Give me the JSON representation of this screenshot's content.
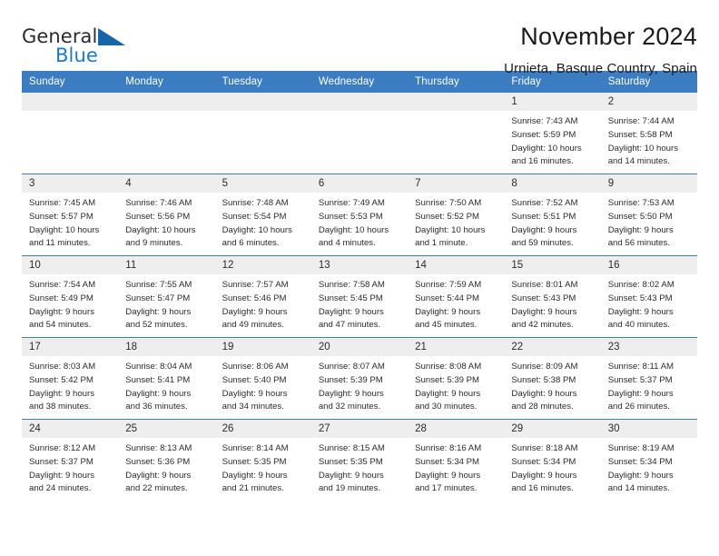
{
  "brand": {
    "name_part1": "General",
    "name_part2": "Blue",
    "triangle_color": "#1565a8",
    "blue_color": "#1f7ac4"
  },
  "header": {
    "title": "November 2024",
    "subtitle": "Urnieta, Basque Country, Spain"
  },
  "theme": {
    "header_blue": "#3b7dc0",
    "daynum_band": "#eeeeee",
    "text": "#2b2b2b"
  },
  "weekday_headers": [
    "Sunday",
    "Monday",
    "Tuesday",
    "Wednesday",
    "Thursday",
    "Friday",
    "Saturday"
  ],
  "weeks": [
    {
      "days": [
        {
          "num": "",
          "blank": true,
          "sunrise": "",
          "sunset": "",
          "daylight_line1": "",
          "daylight_line2": ""
        },
        {
          "num": "",
          "blank": true,
          "sunrise": "",
          "sunset": "",
          "daylight_line1": "",
          "daylight_line2": ""
        },
        {
          "num": "",
          "blank": true,
          "sunrise": "",
          "sunset": "",
          "daylight_line1": "",
          "daylight_line2": ""
        },
        {
          "num": "",
          "blank": true,
          "sunrise": "",
          "sunset": "",
          "daylight_line1": "",
          "daylight_line2": ""
        },
        {
          "num": "",
          "blank": true,
          "sunrise": "",
          "sunset": "",
          "daylight_line1": "",
          "daylight_line2": ""
        },
        {
          "num": "1",
          "blank": false,
          "sunrise": "Sunrise: 7:43 AM",
          "sunset": "Sunset: 5:59 PM",
          "daylight_line1": "Daylight: 10 hours",
          "daylight_line2": "and 16 minutes."
        },
        {
          "num": "2",
          "blank": false,
          "sunrise": "Sunrise: 7:44 AM",
          "sunset": "Sunset: 5:58 PM",
          "daylight_line1": "Daylight: 10 hours",
          "daylight_line2": "and 14 minutes."
        }
      ]
    },
    {
      "days": [
        {
          "num": "3",
          "blank": false,
          "sunrise": "Sunrise: 7:45 AM",
          "sunset": "Sunset: 5:57 PM",
          "daylight_line1": "Daylight: 10 hours",
          "daylight_line2": "and 11 minutes."
        },
        {
          "num": "4",
          "blank": false,
          "sunrise": "Sunrise: 7:46 AM",
          "sunset": "Sunset: 5:56 PM",
          "daylight_line1": "Daylight: 10 hours",
          "daylight_line2": "and 9 minutes."
        },
        {
          "num": "5",
          "blank": false,
          "sunrise": "Sunrise: 7:48 AM",
          "sunset": "Sunset: 5:54 PM",
          "daylight_line1": "Daylight: 10 hours",
          "daylight_line2": "and 6 minutes."
        },
        {
          "num": "6",
          "blank": false,
          "sunrise": "Sunrise: 7:49 AM",
          "sunset": "Sunset: 5:53 PM",
          "daylight_line1": "Daylight: 10 hours",
          "daylight_line2": "and 4 minutes."
        },
        {
          "num": "7",
          "blank": false,
          "sunrise": "Sunrise: 7:50 AM",
          "sunset": "Sunset: 5:52 PM",
          "daylight_line1": "Daylight: 10 hours",
          "daylight_line2": "and 1 minute."
        },
        {
          "num": "8",
          "blank": false,
          "sunrise": "Sunrise: 7:52 AM",
          "sunset": "Sunset: 5:51 PM",
          "daylight_line1": "Daylight: 9 hours",
          "daylight_line2": "and 59 minutes."
        },
        {
          "num": "9",
          "blank": false,
          "sunrise": "Sunrise: 7:53 AM",
          "sunset": "Sunset: 5:50 PM",
          "daylight_line1": "Daylight: 9 hours",
          "daylight_line2": "and 56 minutes."
        }
      ]
    },
    {
      "days": [
        {
          "num": "10",
          "blank": false,
          "sunrise": "Sunrise: 7:54 AM",
          "sunset": "Sunset: 5:49 PM",
          "daylight_line1": "Daylight: 9 hours",
          "daylight_line2": "and 54 minutes."
        },
        {
          "num": "11",
          "blank": false,
          "sunrise": "Sunrise: 7:55 AM",
          "sunset": "Sunset: 5:47 PM",
          "daylight_line1": "Daylight: 9 hours",
          "daylight_line2": "and 52 minutes."
        },
        {
          "num": "12",
          "blank": false,
          "sunrise": "Sunrise: 7:57 AM",
          "sunset": "Sunset: 5:46 PM",
          "daylight_line1": "Daylight: 9 hours",
          "daylight_line2": "and 49 minutes."
        },
        {
          "num": "13",
          "blank": false,
          "sunrise": "Sunrise: 7:58 AM",
          "sunset": "Sunset: 5:45 PM",
          "daylight_line1": "Daylight: 9 hours",
          "daylight_line2": "and 47 minutes."
        },
        {
          "num": "14",
          "blank": false,
          "sunrise": "Sunrise: 7:59 AM",
          "sunset": "Sunset: 5:44 PM",
          "daylight_line1": "Daylight: 9 hours",
          "daylight_line2": "and 45 minutes."
        },
        {
          "num": "15",
          "blank": false,
          "sunrise": "Sunrise: 8:01 AM",
          "sunset": "Sunset: 5:43 PM",
          "daylight_line1": "Daylight: 9 hours",
          "daylight_line2": "and 42 minutes."
        },
        {
          "num": "16",
          "blank": false,
          "sunrise": "Sunrise: 8:02 AM",
          "sunset": "Sunset: 5:43 PM",
          "daylight_line1": "Daylight: 9 hours",
          "daylight_line2": "and 40 minutes."
        }
      ]
    },
    {
      "days": [
        {
          "num": "17",
          "blank": false,
          "sunrise": "Sunrise: 8:03 AM",
          "sunset": "Sunset: 5:42 PM",
          "daylight_line1": "Daylight: 9 hours",
          "daylight_line2": "and 38 minutes."
        },
        {
          "num": "18",
          "blank": false,
          "sunrise": "Sunrise: 8:04 AM",
          "sunset": "Sunset: 5:41 PM",
          "daylight_line1": "Daylight: 9 hours",
          "daylight_line2": "and 36 minutes."
        },
        {
          "num": "19",
          "blank": false,
          "sunrise": "Sunrise: 8:06 AM",
          "sunset": "Sunset: 5:40 PM",
          "daylight_line1": "Daylight: 9 hours",
          "daylight_line2": "and 34 minutes."
        },
        {
          "num": "20",
          "blank": false,
          "sunrise": "Sunrise: 8:07 AM",
          "sunset": "Sunset: 5:39 PM",
          "daylight_line1": "Daylight: 9 hours",
          "daylight_line2": "and 32 minutes."
        },
        {
          "num": "21",
          "blank": false,
          "sunrise": "Sunrise: 8:08 AM",
          "sunset": "Sunset: 5:39 PM",
          "daylight_line1": "Daylight: 9 hours",
          "daylight_line2": "and 30 minutes."
        },
        {
          "num": "22",
          "blank": false,
          "sunrise": "Sunrise: 8:09 AM",
          "sunset": "Sunset: 5:38 PM",
          "daylight_line1": "Daylight: 9 hours",
          "daylight_line2": "and 28 minutes."
        },
        {
          "num": "23",
          "blank": false,
          "sunrise": "Sunrise: 8:11 AM",
          "sunset": "Sunset: 5:37 PM",
          "daylight_line1": "Daylight: 9 hours",
          "daylight_line2": "and 26 minutes."
        }
      ]
    },
    {
      "days": [
        {
          "num": "24",
          "blank": false,
          "sunrise": "Sunrise: 8:12 AM",
          "sunset": "Sunset: 5:37 PM",
          "daylight_line1": "Daylight: 9 hours",
          "daylight_line2": "and 24 minutes."
        },
        {
          "num": "25",
          "blank": false,
          "sunrise": "Sunrise: 8:13 AM",
          "sunset": "Sunset: 5:36 PM",
          "daylight_line1": "Daylight: 9 hours",
          "daylight_line2": "and 22 minutes."
        },
        {
          "num": "26",
          "blank": false,
          "sunrise": "Sunrise: 8:14 AM",
          "sunset": "Sunset: 5:35 PM",
          "daylight_line1": "Daylight: 9 hours",
          "daylight_line2": "and 21 minutes."
        },
        {
          "num": "27",
          "blank": false,
          "sunrise": "Sunrise: 8:15 AM",
          "sunset": "Sunset: 5:35 PM",
          "daylight_line1": "Daylight: 9 hours",
          "daylight_line2": "and 19 minutes."
        },
        {
          "num": "28",
          "blank": false,
          "sunrise": "Sunrise: 8:16 AM",
          "sunset": "Sunset: 5:34 PM",
          "daylight_line1": "Daylight: 9 hours",
          "daylight_line2": "and 17 minutes."
        },
        {
          "num": "29",
          "blank": false,
          "sunrise": "Sunrise: 8:18 AM",
          "sunset": "Sunset: 5:34 PM",
          "daylight_line1": "Daylight: 9 hours",
          "daylight_line2": "and 16 minutes."
        },
        {
          "num": "30",
          "blank": false,
          "sunrise": "Sunrise: 8:19 AM",
          "sunset": "Sunset: 5:34 PM",
          "daylight_line1": "Daylight: 9 hours",
          "daylight_line2": "and 14 minutes."
        }
      ]
    }
  ]
}
